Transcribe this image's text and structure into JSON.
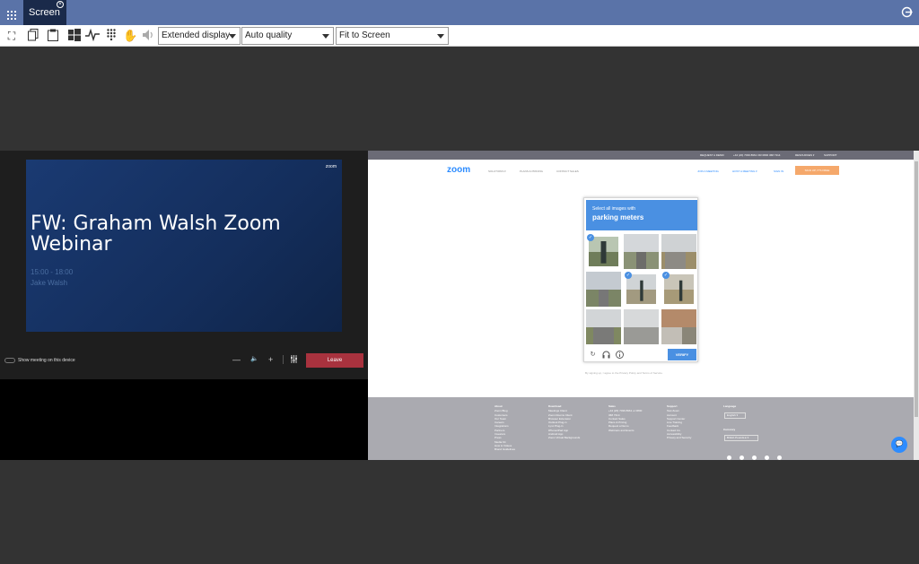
{
  "window": {
    "tab_label": "Screen",
    "tab_close": "×"
  },
  "toolbar": {
    "display_mode": "Extended display",
    "quality": "Auto quality",
    "scaling": "Fit to Screen"
  },
  "remote_left": {
    "slide_logo": "zoom",
    "slide_title": "FW: Graham Walsh Zoom Webinar",
    "slide_time": "15:00 - 18:00",
    "slide_presenter": "Jake Walsh",
    "show_meeting_label": "Show meeting on this device",
    "controls": [
      "—",
      "🔈",
      "+"
    ],
    "leave_label": "Leave"
  },
  "remote_right": {
    "top_links": [
      "REQUEST A DEMO",
      "+44 (20) 7039 8961 OR 0800 368 7314",
      "RESOURCES ▾",
      "SUPPORT"
    ],
    "logo": "zoom",
    "nav_left": [
      "SOLUTIONS ▾",
      "PLANS & PRICING",
      "CONTACT SALES"
    ],
    "nav_right": [
      "JOIN A MEETING",
      "HOST A MEETING ▾",
      "SIGN IN"
    ],
    "signup_label": "SIGN UP, IT'S FREE",
    "captcha": {
      "instruction": "Select all images with",
      "target": "parking meters",
      "verify_label": "VERIFY"
    },
    "terms_text": "By signing up, I agree to the Privacy Policy and Terms of Service.",
    "footer": {
      "columns": [
        {
          "heading": "About",
          "items": [
            "Zoom Blog",
            "Customers",
            "Our Team",
            "Careers",
            "Integrations",
            "Partners",
            "Investors",
            "Press",
            "Media Kit",
            "How to Videos",
            "Brand Guidelines"
          ]
        },
        {
          "heading": "Download",
          "items": [
            "Meetings Client",
            "Zoom Rooms Client",
            "Browser Extension",
            "Outlook Plug-in",
            "Lync Plug-in",
            "iPhone/iPad App",
            "Android App",
            "Zoom Virtual Backgrounds"
          ]
        },
        {
          "heading": "Sales",
          "items": [
            "+44 (20) 7039 8961 or 0800",
            "368 7314",
            "Contact Sales",
            "Plans & Pricing",
            "Request a Demo",
            "Webinars and Events"
          ]
        },
        {
          "heading": "Support",
          "items": [
            "Test Zoom",
            "Account",
            "Support Center",
            "Live Training",
            "Feedback",
            "Contact Us",
            "Accessibility",
            "Privacy and Security"
          ]
        }
      ],
      "language_heading": "Language",
      "language_value": "English ▾",
      "currency_heading": "Currency",
      "currency_value": "British Pounds £ ▾"
    }
  },
  "colors": {
    "titlebar": "#5a73a8",
    "leave": "#a8323e",
    "zoom_blue": "#2d8cff",
    "captcha_blue": "#4a90e2"
  }
}
